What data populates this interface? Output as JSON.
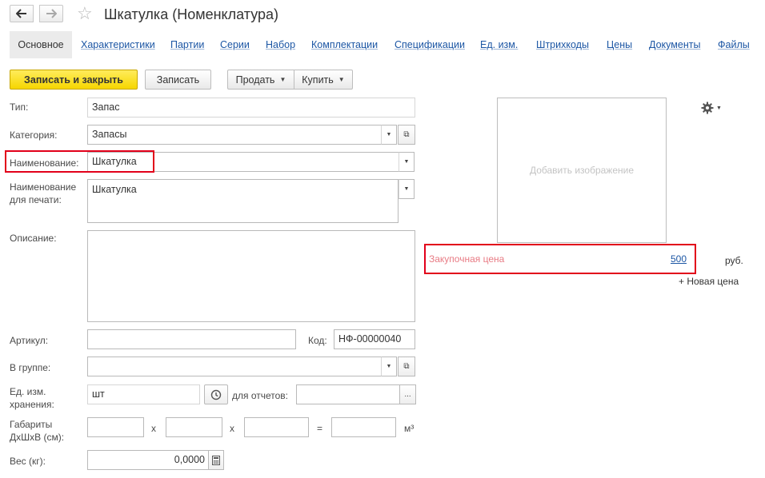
{
  "header": {
    "title": "Шкатулка (Номенклатура)"
  },
  "tabs": [
    {
      "label": "Основное",
      "active": true
    },
    {
      "label": "Характеристики"
    },
    {
      "label": "Партии"
    },
    {
      "label": "Серии"
    },
    {
      "label": "Набор"
    },
    {
      "label": "Комплектации"
    },
    {
      "label": "Спецификации"
    },
    {
      "label": "Ед. изм."
    },
    {
      "label": "Штрихкоды"
    },
    {
      "label": "Цены"
    },
    {
      "label": "Документы"
    },
    {
      "label": "Файлы"
    }
  ],
  "toolbar": {
    "save_close": "Записать и закрыть",
    "save": "Записать",
    "sell": "Продать",
    "buy": "Купить"
  },
  "form": {
    "type_label": "Тип:",
    "type_value": "Запас",
    "category_label": "Категория:",
    "category_value": "Запасы",
    "name_label": "Наименование:",
    "name_value": "Шкатулка",
    "print_name_label_1": "Наименование",
    "print_name_label_2": "для печати:",
    "print_name_value": "Шкатулка",
    "description_label": "Описание:",
    "description_value": "",
    "article_label": "Артикул:",
    "article_value": "",
    "code_label": "Код:",
    "code_value": "НФ-00000040",
    "group_label": "В группе:",
    "group_value": "",
    "unit_label_1": "Ед. изм.",
    "unit_label_2": "хранения:",
    "unit_value": "шт",
    "reports_label": "для отчетов:",
    "reports_value": "",
    "dims_label_1": "Габариты",
    "dims_label_2": "ДхШхВ (см):",
    "dims_x": "x",
    "dims_eq": "=",
    "dims_unit": "м³",
    "weight_label": "Вес (кг):",
    "weight_value": "0,0000"
  },
  "side": {
    "add_image": "Добавить изображение",
    "purchase_price_label": "Закупочная цена",
    "purchase_price_value": "500",
    "currency": "руб.",
    "new_price": "+ Новая цена"
  },
  "colors": {
    "accent_yellow": "#f6d600",
    "link_blue": "#1c56a4",
    "highlight_red": "#e2001a",
    "price_label": "#e87b84"
  }
}
